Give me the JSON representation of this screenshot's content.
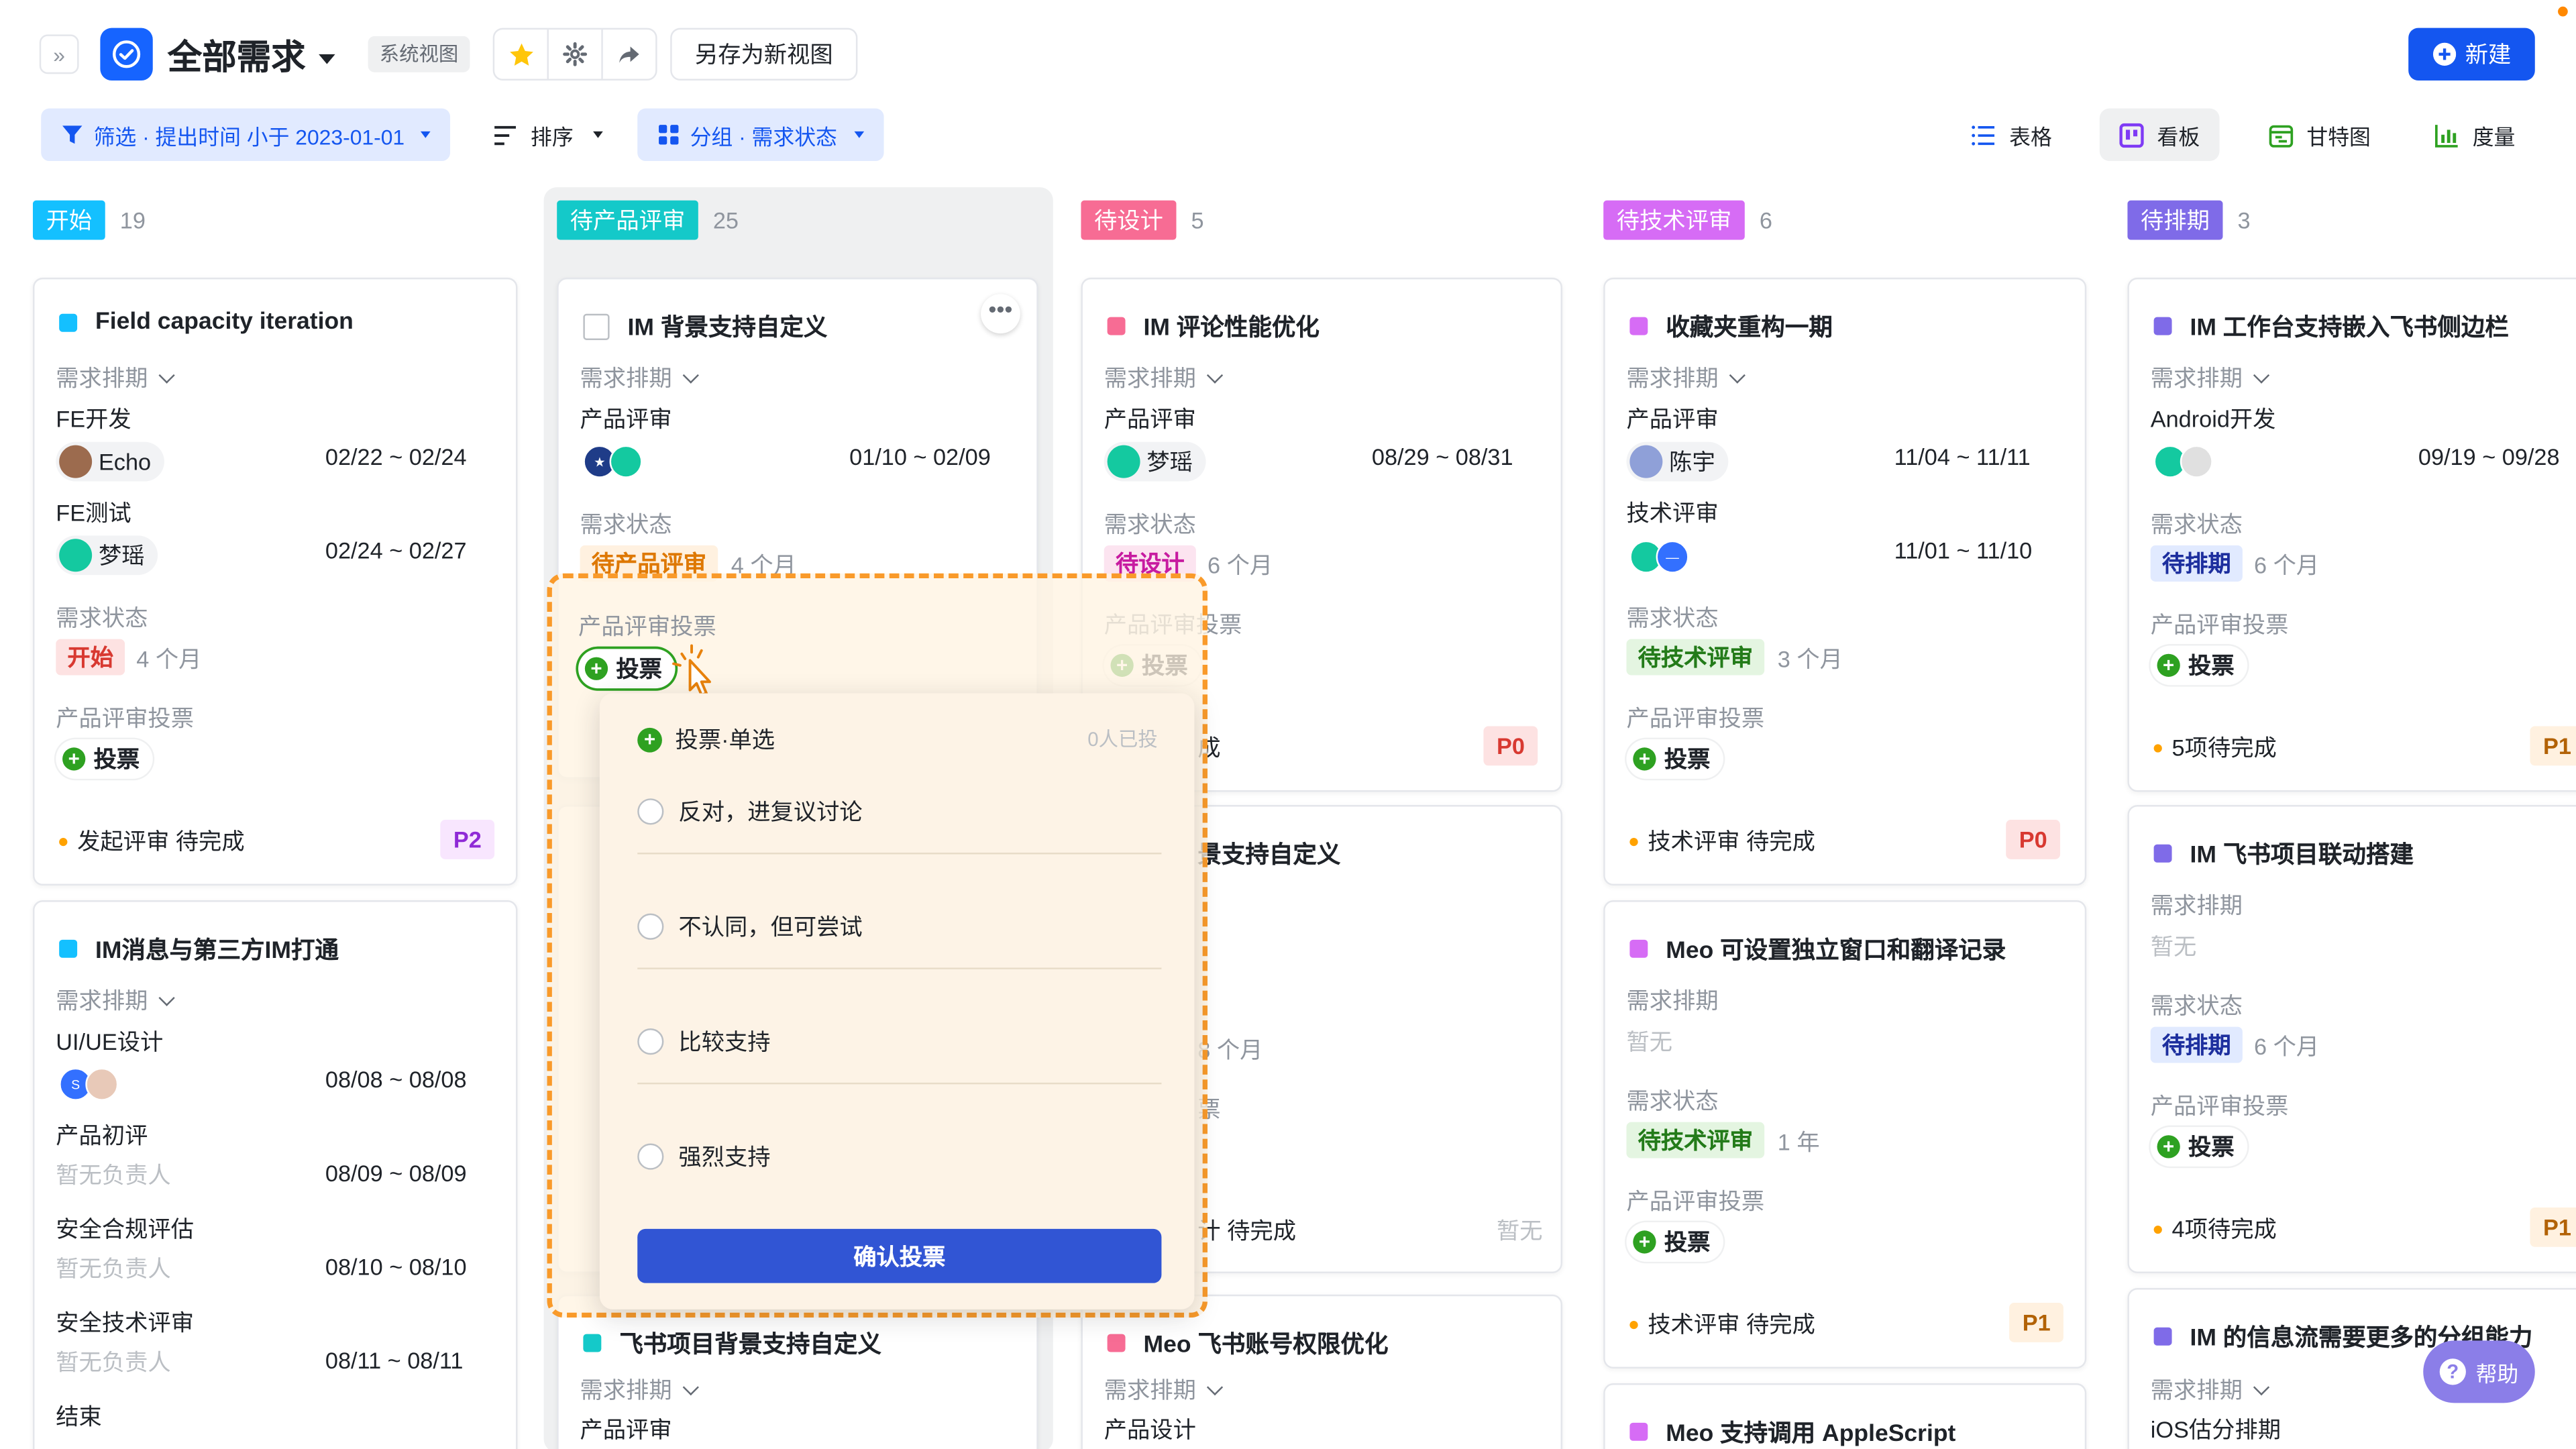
{
  "header": {
    "expand_icon": "»",
    "title": "全部需求",
    "system_view_tag": "系统视图",
    "save_as_new_view": "另存为新视图",
    "new_button": "新建"
  },
  "toolbar": {
    "filter_label": "筛选 · 提出时间 小于 2023-01-01",
    "sort_label": "排序",
    "group_label": "分组 · 需求状态",
    "views": [
      "表格",
      "看板",
      "甘特图",
      "度量"
    ],
    "active_view": "看板"
  },
  "columns": [
    {
      "name": "开始",
      "count": "19",
      "color": "#14c0ff"
    },
    {
      "name": "待产品评审",
      "count": "25",
      "color": "#14c9c9"
    },
    {
      "name": "待设计",
      "count": "5",
      "color": "#f76c94"
    },
    {
      "name": "待技术评审",
      "count": "6",
      "color": "#d66cf5"
    },
    {
      "name": "待排期",
      "count": "3",
      "color": "#7f6be8"
    }
  ],
  "labels": {
    "schedule": "需求排期",
    "status": "需求状态",
    "vote": "产品评审投票",
    "vote_button": "投票",
    "no_owner": "暂无负责人",
    "none": "暂无"
  },
  "cards": {
    "c1": {
      "title": "Field capacity iteration",
      "rows": [
        {
          "stage": "FE开发",
          "person": "Echo",
          "date": "02/22 ~ 02/24"
        },
        {
          "stage": "FE测试",
          "person": "梦瑶",
          "date": "02/24 ~ 02/27"
        }
      ],
      "status": "开始",
      "status_age": "4 个月",
      "footer": "发起评审 待完成",
      "priority": "P2"
    },
    "c2": {
      "title": "IM消息与第三方IM打通",
      "rows": [
        {
          "stage": "UI/UE设计",
          "date": "08/08 ~ 08/08"
        },
        {
          "stage": "产品初评",
          "person": "暂无负责人",
          "date": "08/09 ~ 08/09"
        },
        {
          "stage": "安全合规评估",
          "person": "暂无负责人",
          "date": "08/10 ~ 08/10"
        },
        {
          "stage": "安全技术评审",
          "person": "暂无负责人",
          "date": "08/11 ~ 08/11"
        },
        {
          "stage": "结束"
        }
      ]
    },
    "c3": {
      "title": "IM 背景支持自定义",
      "stage": "产品评审",
      "date": "01/10 ~ 02/09",
      "status": "待产品评审",
      "status_age": "4 个月"
    },
    "c4": {
      "title": "飞书项目背景支持自定义",
      "stage": "产品评审"
    },
    "c5": {
      "title": "IM 评论性能优化",
      "stage": "产品评审",
      "person": "梦瑶",
      "date": "08/29 ~ 08/31",
      "status": "待设计",
      "status_age": "6 个月",
      "footer": "成",
      "priority": "P0"
    },
    "c6": {
      "title": "景支持自定义",
      "status_age": "8 个月",
      "vote_partial": "票",
      "footer": "计 待完成",
      "priority": "暂无"
    },
    "c7": {
      "title": "Meo 飞书账号权限优化",
      "stage": "产品设计"
    },
    "c8": {
      "title": "收藏夹重构一期",
      "rows": [
        {
          "stage": "产品评审",
          "person": "陈宇",
          "date": "11/04 ~ 11/11"
        },
        {
          "stage": "技术评审",
          "date": "11/01 ~ 11/10"
        }
      ],
      "status": "待技术评审",
      "status_age": "3 个月",
      "footer": "技术评审 待完成",
      "priority": "P0"
    },
    "c9": {
      "title": "Meo 可设置独立窗口和翻译记录",
      "status": "待技术评审",
      "status_age": "1 年",
      "footer": "技术评审 待完成",
      "priority": "P1"
    },
    "c10": {
      "title": "Meo 支持调用 AppleScript"
    },
    "c11": {
      "title": "IM 工作台支持嵌入飞书侧边栏",
      "stage": "Android开发",
      "date": "09/19 ~ 09/28",
      "status": "待排期",
      "status_age": "6 个月",
      "footer": "5项待完成",
      "priority": "P1"
    },
    "c12": {
      "title": "IM 飞书项目联动搭建",
      "status": "待排期",
      "status_age": "6 个月",
      "footer": "4项待完成",
      "priority": "P1"
    },
    "c13": {
      "title": "IM 的信息流需要更多的分组能力",
      "stage": "iOS估分排期"
    }
  },
  "vote_popup": {
    "title": "投票·单选",
    "voted_count": "0人已投",
    "options": [
      "反对，进复议讨论",
      "不认同，但可尝试",
      "比较支持",
      "强烈支持"
    ],
    "confirm": "确认投票"
  },
  "help_button": "帮助",
  "colors": {
    "accent": "#1456f0",
    "highlight_border": "#f99a2a"
  }
}
